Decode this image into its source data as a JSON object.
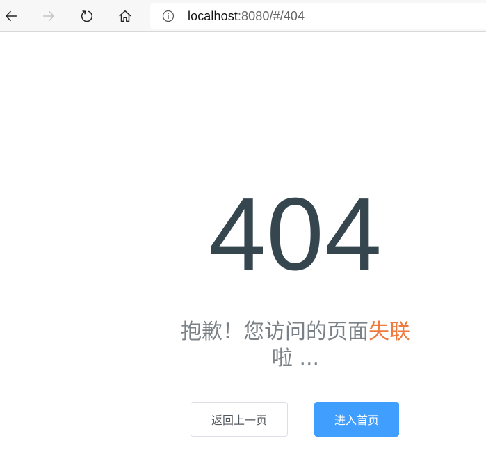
{
  "browser": {
    "url_host": "localhost",
    "url_rest": ":8080/#/404",
    "icons": {
      "back": "back-arrow-icon",
      "forward": "forward-arrow-icon",
      "reload": "reload-icon",
      "home": "home-icon",
      "info": "info-icon"
    }
  },
  "error_page": {
    "code": "404",
    "message_prefix": "抱歉！您访问的页面",
    "message_highlight": "失联",
    "message_suffix": "啦 ...",
    "back_button_label": "返回上一页",
    "home_button_label": "进入首页"
  },
  "colors": {
    "code_text": "#35464f",
    "message_text": "#7b8287",
    "highlight": "#ef7a3d",
    "primary_button": "#409eff"
  }
}
